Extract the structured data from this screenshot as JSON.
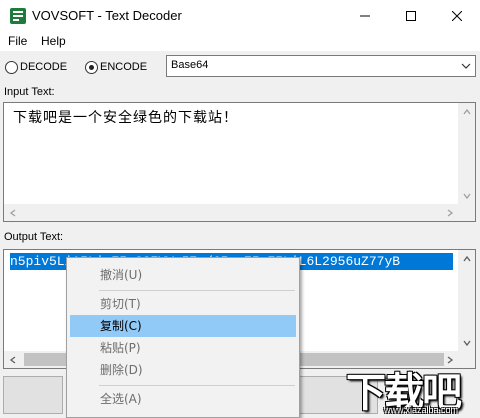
{
  "window": {
    "title": "VOVSOFT - Text Decoder"
  },
  "menu": {
    "items": [
      "File",
      "Help"
    ]
  },
  "mode": {
    "decode_label": "DECODE",
    "encode_label": "ENCODE",
    "selected": "ENCODE",
    "encoding": "Base64"
  },
  "input": {
    "label": "Input Text:",
    "value": "下载吧是一个安全绿色的下载站！"
  },
  "output": {
    "label": "Output Text:",
    "value": "n5piv5LiA5LiqE5qC3FYWa57u/6ImyE5pE5LiL6L2956uZ77yB"
  },
  "context_menu": {
    "items": [
      {
        "label": "撤消(U)",
        "enabled": false
      },
      {
        "label": "剪切(T)",
        "enabled": false
      },
      {
        "label": "复制(C)",
        "enabled": true,
        "highlighted": true
      },
      {
        "label": "粘贴(P)",
        "enabled": false
      },
      {
        "label": "删除(D)",
        "enabled": false
      },
      {
        "label": "全选(A)",
        "enabled": false
      }
    ]
  },
  "watermark": {
    "text": "下载吧",
    "url": "www.xiazaiba.com"
  },
  "colors": {
    "selection": "#0078d7",
    "menu_highlight": "#91c9f7"
  }
}
